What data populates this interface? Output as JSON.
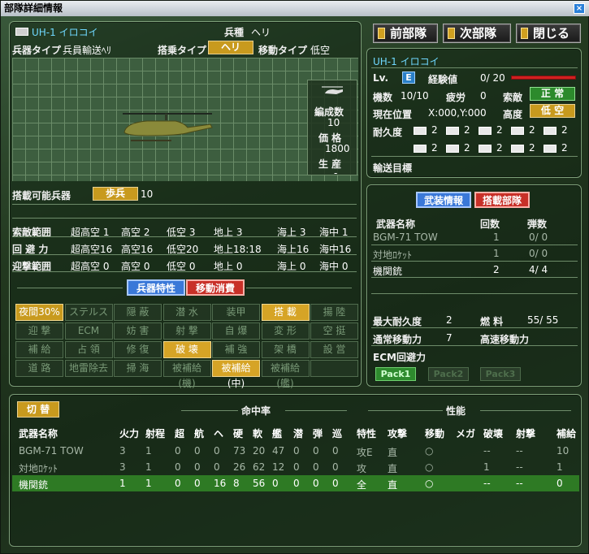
{
  "window": {
    "title": "部隊詳細情報"
  },
  "top_buttons": {
    "prev": "前部隊",
    "next": "次部隊",
    "close": "閉じる"
  },
  "unit": {
    "name": "UH-1 イロコイ",
    "type_label": "兵種",
    "type_value": "ヘリ",
    "weapon_type_label": "兵器タイプ",
    "weapon_type_value": "兵員輸送ﾍﾘ",
    "board_type_label": "搭乗タイプ",
    "board_type_value": "ヘリ",
    "move_type_label": "移動タイプ",
    "move_type_value": "低空"
  },
  "preview": {
    "formation_label": "編成数",
    "formation_value": "10",
    "price_label": "価 格",
    "price_value": "1800",
    "production_label": "生 産",
    "production_value": "-"
  },
  "loadable": {
    "label": "搭載可能兵器",
    "type": "歩兵",
    "count": "10"
  },
  "ranges": [
    {
      "label": "索敵範囲",
      "cols": [
        "超高空 1",
        "高空 2",
        "低空 3",
        "地上 3",
        "海上 3",
        "海中 1"
      ]
    },
    {
      "label": "回 避 力",
      "cols": [
        "超高空16",
        "高空16",
        "低空20",
        "地上18:18",
        "海上16",
        "海中16"
      ]
    },
    {
      "label": "迎撃範囲",
      "cols": [
        "超高空 0",
        "高空 0",
        "低空 0",
        "地上 0",
        "海上 0",
        "海中 0"
      ]
    }
  ],
  "feature_tabs": {
    "traits": "兵器特性",
    "move_cost": "移動消費"
  },
  "traits": [
    [
      "夜間30%",
      "ステルス",
      "隠 蔽",
      "潜 水",
      "装甲",
      "搭 載",
      "揚 陸"
    ],
    [
      "迎 撃",
      "ECM",
      "妨 害",
      "射 撃",
      "自 爆",
      "変 形",
      "空 挺"
    ],
    [
      "補 給",
      "占 領",
      "修 復",
      "破 壊",
      "補 強",
      "架 橋",
      "設 営"
    ],
    [
      "道 路",
      "地雷除去",
      "掃 海",
      "被補給(機)",
      "被補給(中)",
      "被補給(艦)",
      ""
    ]
  ],
  "status": {
    "name": "UH-1 イロコイ",
    "lv_label": "Lv.",
    "lv_value": "E",
    "exp_label": "経験値",
    "exp_value": "0/ 20",
    "count_label": "機数",
    "count_value": "10/10",
    "fatigue_label": "疲労",
    "fatigue_value": "0",
    "morale_label": "索敵",
    "morale_value": "正 常",
    "pos_label": "現在位置",
    "pos_value": "X:000,Y:000",
    "alt_label": "高度",
    "alt_value": "低 空",
    "dur_label": "耐久度",
    "dur_values": [
      "2",
      "2",
      "2",
      "2",
      "2",
      "2",
      "2",
      "2",
      "2",
      "2"
    ],
    "transport_label": "輸送目標"
  },
  "weapons_panel": {
    "tab_arms": "武装情報",
    "tab_loaded": "搭載部隊",
    "headers": [
      "武器名称",
      "回数",
      "弾数"
    ],
    "rows": [
      [
        "BGM-71 TOW",
        "1",
        "0/ 0"
      ],
      [
        "対地ﾛｹｯﾄ",
        "1",
        "0/ 0"
      ],
      [
        "機関銃",
        "2",
        "4/ 4"
      ]
    ]
  },
  "stats": {
    "max_dur_label": "最大耐久度",
    "max_dur_value": "2",
    "fuel_label": "燃 料",
    "fuel_value": "55/ 55",
    "move_label": "通常移動力",
    "move_value": "7",
    "fast_label": "高速移動力",
    "ecm_label": "ECM回避力",
    "packs": [
      "Pack1",
      "Pack2",
      "Pack3"
    ]
  },
  "bottom": {
    "switch": "切 替",
    "hit_label": "命中率",
    "perf_label": "性能",
    "headers": [
      "武器名称",
      "火力",
      "射程",
      "超",
      "航",
      "ヘ",
      "硬",
      "軟",
      "艦",
      "潜",
      "弾",
      "巡",
      "特性",
      "攻撃",
      "移動",
      "メガ",
      "破壊",
      "射撃",
      "補給"
    ],
    "rows": [
      [
        "BGM-71 TOW",
        "3",
        "1",
        "0",
        "0",
        "0",
        "73",
        "20",
        "47",
        "0",
        "0",
        "0",
        "攻E",
        "直",
        "○",
        "",
        "--",
        "--",
        "10"
      ],
      [
        "対地ﾛｹｯﾄ",
        "3",
        "1",
        "0",
        "0",
        "0",
        "26",
        "62",
        "12",
        "0",
        "0",
        "0",
        "攻",
        "直",
        "○",
        "",
        "1",
        "--",
        "1"
      ],
      [
        "機関銃",
        "1",
        "1",
        "0",
        "0",
        "16",
        "8",
        "56",
        "0",
        "0",
        "0",
        "0",
        "全",
        "直",
        "○",
        "",
        "--",
        "--",
        "0"
      ]
    ]
  },
  "colors": {
    "accent_gold": "#c89a1e",
    "accent_green": "#2c8a2c",
    "highlight_row": "#2e7a24",
    "exp_bar": "#d02020"
  }
}
